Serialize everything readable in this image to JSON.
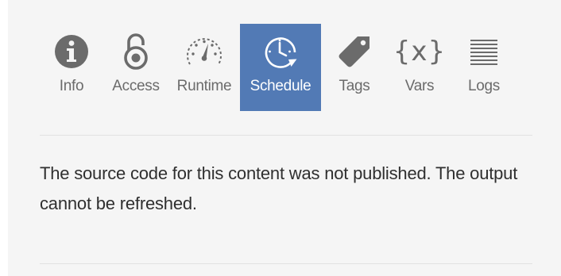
{
  "tabs": [
    {
      "label": "Info",
      "icon": "info-icon",
      "active": false
    },
    {
      "label": "Access",
      "icon": "padlock-icon",
      "active": false
    },
    {
      "label": "Runtime",
      "icon": "speedometer-icon",
      "active": false
    },
    {
      "label": "Schedule",
      "icon": "clock-icon",
      "active": true
    },
    {
      "label": "Tags",
      "icon": "tag-icon",
      "active": false
    },
    {
      "label": "Vars",
      "icon": "vars-icon",
      "active": false
    },
    {
      "label": "Logs",
      "icon": "lines-icon",
      "active": false
    }
  ],
  "vars_glyph": "{x}",
  "message": "The source code for this content was not published. The output cannot be refreshed.",
  "colors": {
    "active_tab_bg": "#527ab5",
    "icon_gray": "#6b6b6b",
    "panel_bg": "#f5f5f5",
    "divider": "#e1e1e1"
  }
}
